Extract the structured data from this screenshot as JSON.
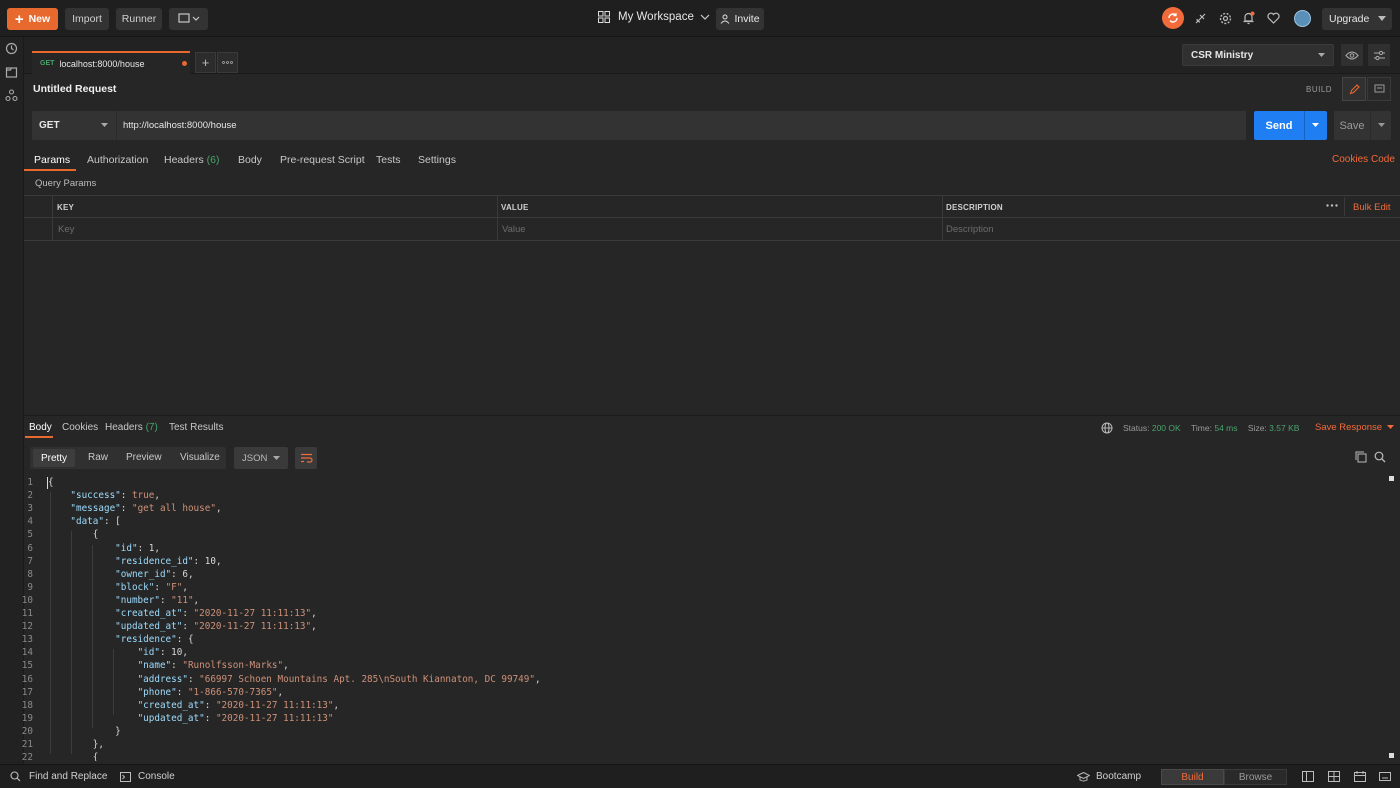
{
  "topbar": {
    "new_label": "New",
    "import_label": "Import",
    "runner_label": "Runner",
    "workspace_label": "My Workspace",
    "invite_label": "Invite",
    "upgrade_label": "Upgrade"
  },
  "colors": {
    "accent": "#e8692e",
    "send": "#1f7ef2",
    "status_green": "#49a36b"
  },
  "tab": {
    "method": "GET",
    "title": "localhost:8000/house"
  },
  "environment": {
    "selected": "CSR Ministry"
  },
  "request": {
    "name": "Untitled Request",
    "build_label": "BUILD",
    "method": "GET",
    "url": "http://localhost:8000/house",
    "send_label": "Send",
    "save_label": "Save"
  },
  "request_tabs": {
    "params": "Params",
    "authorization": "Authorization",
    "headers": "Headers",
    "headers_count": "(6)",
    "body": "Body",
    "prerequest": "Pre-request Script",
    "tests": "Tests",
    "settings": "Settings",
    "cookies": "Cookies",
    "code": "Code"
  },
  "params": {
    "section_title": "Query Params",
    "col_key": "KEY",
    "col_value": "VALUE",
    "col_description": "DESCRIPTION",
    "bulk_edit": "Bulk Edit",
    "key_placeholder": "Key",
    "value_placeholder": "Value",
    "description_placeholder": "Description"
  },
  "response": {
    "tabs": {
      "body": "Body",
      "cookies": "Cookies",
      "headers": "Headers",
      "headers_count": "(7)",
      "tests": "Test Results"
    },
    "status_label": "Status:",
    "status_value": "200 OK",
    "time_label": "Time:",
    "time_value": "54 ms",
    "size_label": "Size:",
    "size_value": "3.57 KB",
    "save_response": "Save Response",
    "views": {
      "pretty": "Pretty",
      "raw": "Raw",
      "preview": "Preview",
      "visualize": "Visualize"
    },
    "format": "JSON"
  },
  "code_lines": [
    "{",
    "    \"success\": true,",
    "    \"message\": \"get all house\",",
    "    \"data\": [",
    "        {",
    "            \"id\": 1,",
    "            \"residence_id\": 10,",
    "            \"owner_id\": 6,",
    "            \"block\": \"F\",",
    "            \"number\": \"11\",",
    "            \"created_at\": \"2020-11-27 11:11:13\",",
    "            \"updated_at\": \"2020-11-27 11:11:13\",",
    "            \"residence\": {",
    "                \"id\": 10,",
    "                \"name\": \"Runolfsson-Marks\",",
    "                \"address\": \"66997 Schoen Mountains Apt. 285\\nSouth Kiannaton, DC 99749\",",
    "                \"phone\": \"1-866-570-7365\",",
    "                \"created_at\": \"2020-11-27 11:11:13\",",
    "                \"updated_at\": \"2020-11-27 11:11:13\"",
    "            }",
    "        },",
    "        {"
  ],
  "bottombar": {
    "find_replace": "Find and Replace",
    "console": "Console",
    "bootcamp": "Bootcamp",
    "build": "Build",
    "browse": "Browse"
  }
}
